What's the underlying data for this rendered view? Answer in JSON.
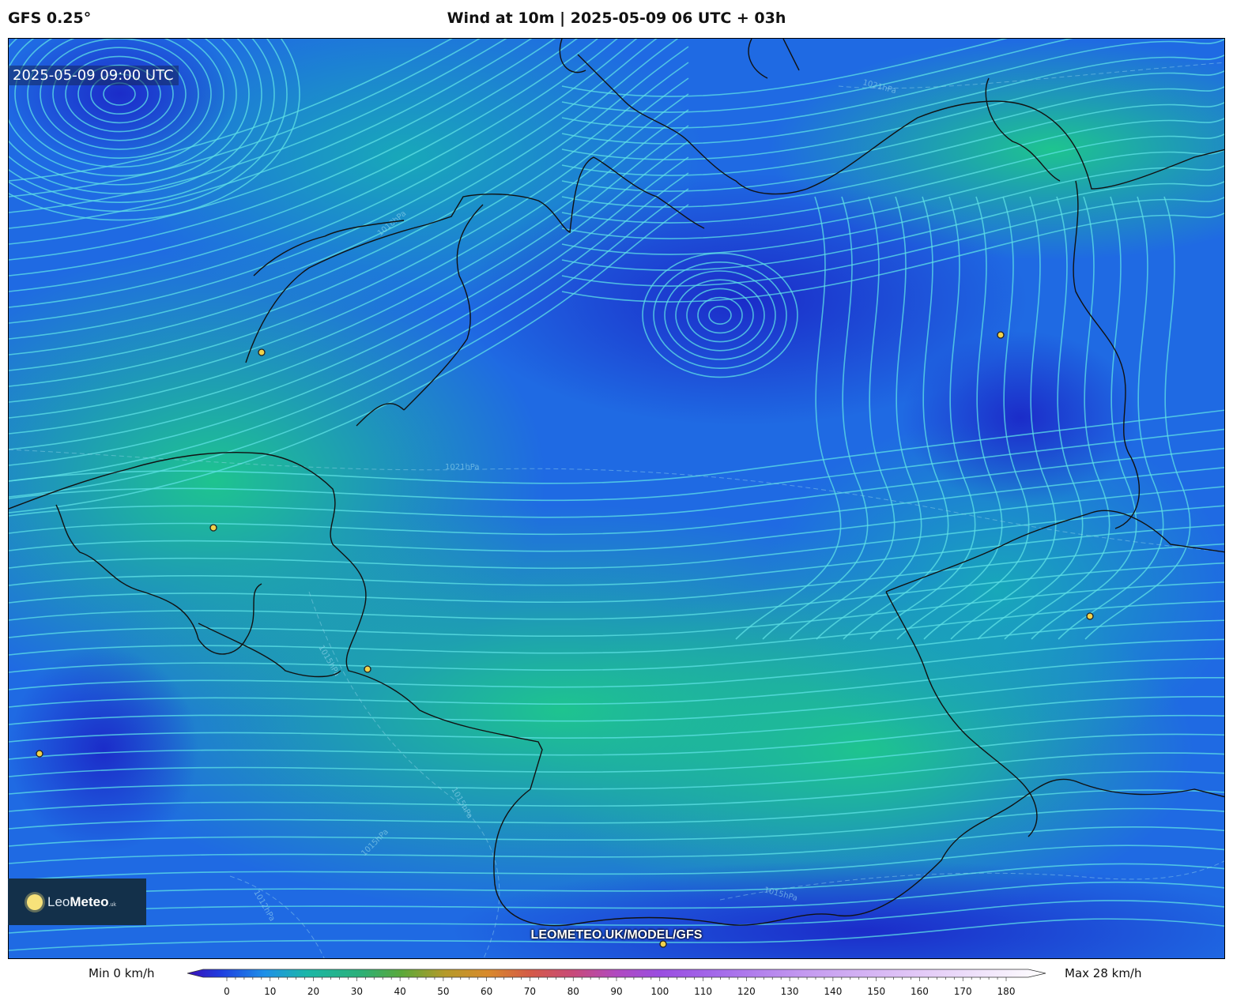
{
  "header": {
    "model": "GFS 0.25°",
    "title": "Wind at 10m | 2025-05-09 06 UTC + 03h"
  },
  "map": {
    "timestamp": "2025-05-09 09:00 UTC",
    "isobar_labels": [
      "1021hPa",
      "1021hPa",
      "1018hPa",
      "1015hPa",
      "1015hPa",
      "1015hPa",
      "1015hPa",
      "1012hPa"
    ],
    "colors": {
      "calm": "#1e2fd8",
      "light": "#1f6fe6",
      "moderate": "#17a6b8",
      "fresh": "#1ec48f",
      "streamline": "#5fe1e6",
      "coastline": "#111111",
      "city_marker": "#f2d24a"
    },
    "cities_count_visible": 7
  },
  "branding": {
    "logo_prefix": "Leo",
    "logo_bold": "Meteo",
    "logo_suffix": ".uk",
    "url": "LEOMETEO.UK/MODEL/GFS"
  },
  "legend": {
    "min_label": "Min 0 km/h",
    "max_label": "Max 28 km/h",
    "unit": "km/h",
    "ticks": [
      "0",
      "10",
      "20",
      "30",
      "40",
      "50",
      "60",
      "70",
      "80",
      "90",
      "100",
      "110",
      "120",
      "130",
      "140",
      "150",
      "160",
      "170",
      "180"
    ],
    "range": [
      0,
      180
    ]
  }
}
